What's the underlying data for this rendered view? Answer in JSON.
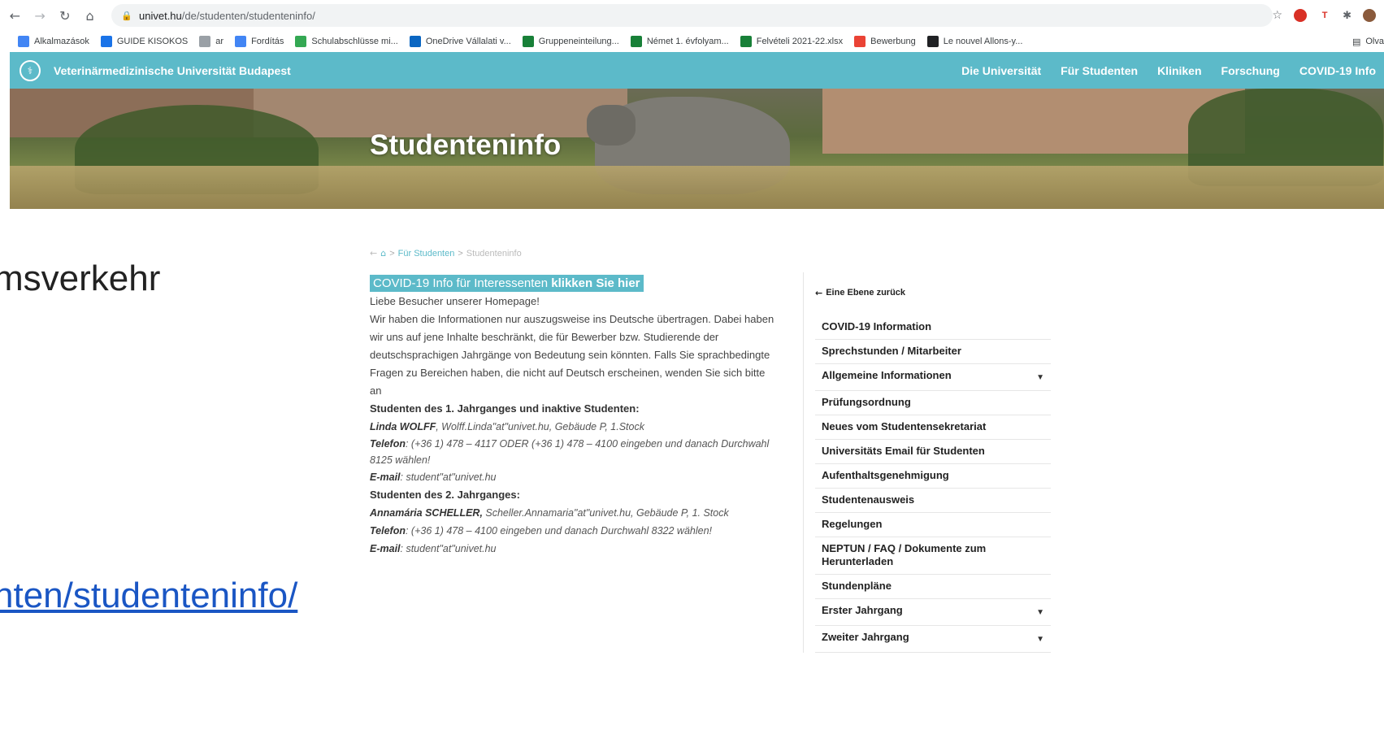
{
  "browser": {
    "url_host": "univet.hu",
    "url_path": "/de/studenten/studenteninfo/",
    "bookmarks": [
      {
        "label": "Alkalmazások",
        "color": "#4285f4"
      },
      {
        "label": "GUIDE KISOKOS",
        "color": "#1a73e8"
      },
      {
        "label": "ar",
        "color": "#9aa0a6"
      },
      {
        "label": "Fordítás",
        "color": "#4285f4"
      },
      {
        "label": "Schulabschlüsse mi...",
        "color": "#34a853"
      },
      {
        "label": "OneDrive Vállalati v...",
        "color": "#0a66c2"
      },
      {
        "label": "Gruppeneinteilung...",
        "color": "#188038"
      },
      {
        "label": "Német 1. évfolyam...",
        "color": "#188038"
      },
      {
        "label": "Felvételi 2021-22.xlsx",
        "color": "#188038"
      },
      {
        "label": "Bewerbung",
        "color": "#ea4335"
      },
      {
        "label": "Le nouvel Allons-y...",
        "color": "#202124"
      }
    ],
    "reading_list": "Olva"
  },
  "slide": {
    "text_top": "msverkehr",
    "text_link": "nten/studenteninfo/"
  },
  "site": {
    "name": "Veterinärmedizinische Universität Budapest",
    "nav": [
      "Die Universität",
      "Für Studenten",
      "Kliniken",
      "Forschung",
      "COVID-19 Info"
    ],
    "hero_title": "Studenteninfo"
  },
  "breadcrumb": {
    "parent": "Für Studenten",
    "current": "Studenteninfo"
  },
  "content": {
    "covid_prefix": "COVID-19 Info für Interessenten ",
    "covid_link": "klikken Sie hier",
    "greeting": "Liebe Besucher unserer Homepage!",
    "intro": "Wir haben die Informationen nur auszugsweise ins Deutsche übertragen. Dabei haben wir uns auf jene Inhalte beschränkt, die für Bewerber bzw. Studierende der deutschsprachigen Jahrgänge von Bedeutung sein könnten. Falls Sie sprachbedingte Fragen zu Bereichen haben, die nicht auf Deutsch erscheinen, wenden Sie sich bitte an",
    "section1": {
      "heading": "Studenten des 1. Jahrganges und inaktive Studenten:",
      "contact_name": "Linda WOLFF",
      "contact_rest": ", Wolff.Linda\"at\"univet.hu, Gebäude P, 1.Stock",
      "phone_label": "Telefon",
      "phone_rest": ": (+36 1) 478 – 4117 ODER (+36 1) 478 – 4100 eingeben und danach Durchwahl 8125 wählen!",
      "email_label": "E-mail",
      "email_rest": ": student\"at\"univet.hu"
    },
    "section2": {
      "heading": "Studenten des 2. Jahrganges:",
      "contact_name": "Annamária SCHELLER,",
      "contact_rest": " Scheller.Annamaria\"at\"univet.hu, Gebäude P, 1. Stock",
      "phone_label": "Telefon",
      "phone_rest": ": (+36 1) 478 – 4100 eingeben und danach Durchwahl 8322 wählen!",
      "email_label": "E-mail",
      "email_rest": ": student\"at\"univet.hu"
    }
  },
  "sidebar": {
    "back": "Eine Ebene zurück",
    "items": [
      {
        "label": "COVID-19 Information",
        "expandable": false
      },
      {
        "label": "Sprechstunden / Mitarbeiter",
        "expandable": false
      },
      {
        "label": "Allgemeine Informationen",
        "expandable": true
      },
      {
        "label": "Prüfungsordnung",
        "expandable": false
      },
      {
        "label": "Neues vom Studentensekretariat",
        "expandable": false
      },
      {
        "label": "Universitäts Email für Studenten",
        "expandable": false
      },
      {
        "label": "Aufenthaltsgenehmigung",
        "expandable": false
      },
      {
        "label": "Studentenausweis",
        "expandable": false
      },
      {
        "label": "Regelungen",
        "expandable": false
      },
      {
        "label": "NEPTUN / FAQ / Dokumente zum Herunterladen",
        "expandable": false
      },
      {
        "label": "Stundenpläne",
        "expandable": false
      },
      {
        "label": "Erster Jahrgang",
        "expandable": true
      },
      {
        "label": "Zweiter Jahrgang",
        "expandable": true
      }
    ]
  },
  "colors": {
    "brand": "#5cbac9"
  }
}
